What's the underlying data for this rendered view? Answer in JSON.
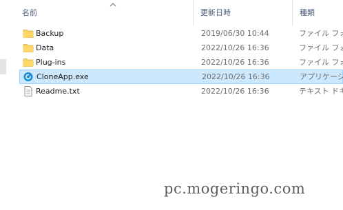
{
  "columns": {
    "name": "名前",
    "date_modified": "更新日時",
    "type": "種類",
    "sort_indicator": "chevron-up-icon"
  },
  "files": [
    {
      "name": "Backup",
      "date": "2019/06/30 10:44",
      "type": "ファイル フォル",
      "icon": "folder-icon"
    },
    {
      "name": "Data",
      "date": "2022/10/26 16:36",
      "type": "ファイル フォル",
      "icon": "folder-icon"
    },
    {
      "name": "Plug-ins",
      "date": "2022/10/26 16:36",
      "type": "ファイル フォル",
      "icon": "folder-icon"
    },
    {
      "name": "CloneApp.exe",
      "date": "2022/10/26 16:36",
      "type": "アプリケーショ",
      "icon": "app-icon",
      "selected": true
    },
    {
      "name": "Readme.txt",
      "date": "2022/10/26 16:36",
      "type": "テキスト ドキュ",
      "icon": "text-file-icon"
    }
  ],
  "watermark": "pc.mogeringo.com",
  "colors": {
    "selection_background": "#cce8ff",
    "selection_border": "#99d1ff",
    "folder": "#f6d36b",
    "app_icon": "#1a8fd8",
    "header_text": "#4c607a"
  }
}
